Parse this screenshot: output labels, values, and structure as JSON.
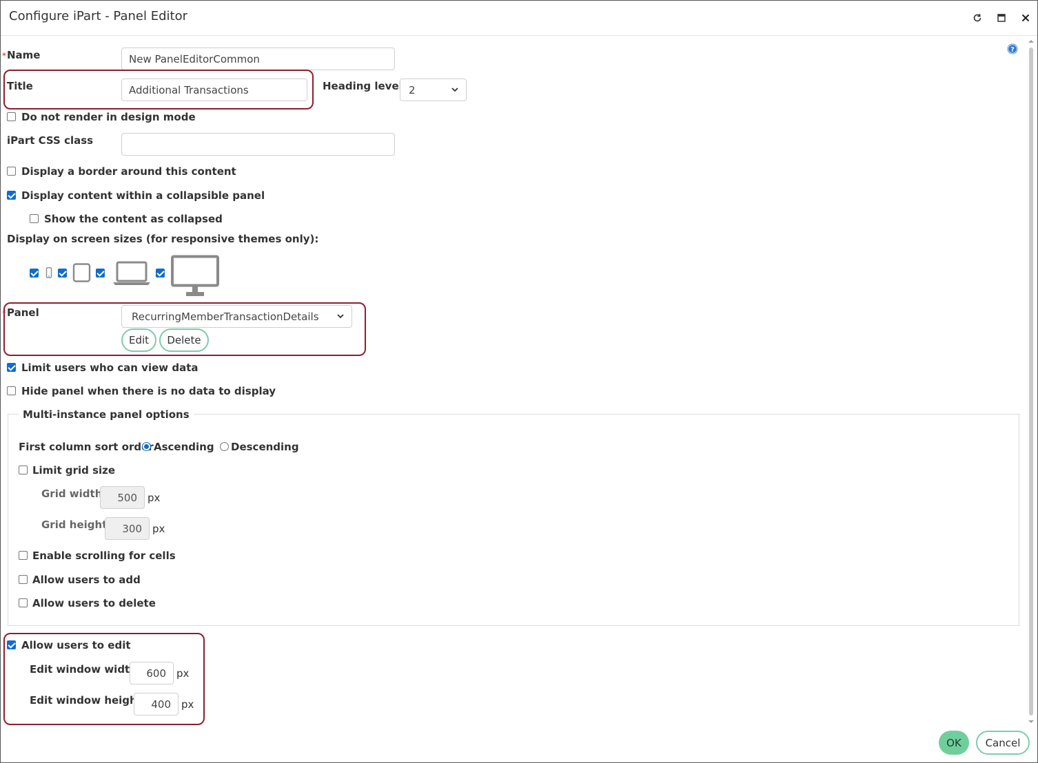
{
  "window": {
    "title": "Configure iPart - Panel Editor"
  },
  "form": {
    "name_label": "Name",
    "name_value": "New PanelEditorCommon",
    "title_label": "Title",
    "title_value": "Additional Transactions",
    "heading_level_label": "Heading level",
    "heading_level_value": "2",
    "no_render_label": "Do not render in design mode",
    "css_class_label": "iPart CSS class",
    "css_class_value": "",
    "border_label": "Display a border around this content",
    "collapsible_label": "Display content within a collapsible panel",
    "collapsed_label": "Show the content as collapsed",
    "screen_sizes_label": "Display on screen sizes (for responsive themes only):",
    "panel_label": "Panel",
    "panel_value": "RecurringMemberTransactionDetails",
    "edit_button": "Edit",
    "delete_button": "Delete",
    "limit_view_label": "Limit users who can view data",
    "hide_panel_label": "Hide panel when there is no data to display"
  },
  "multi": {
    "legend": "Multi-instance panel options",
    "sort_label": "First column sort order",
    "ascending": "Ascending",
    "descending": "Descending",
    "limit_grid_label": "Limit grid size",
    "grid_width_label": "Grid width",
    "grid_width_value": "500",
    "grid_height_label": "Grid height",
    "grid_height_value": "300",
    "px": "px",
    "scrolling_label": "Enable scrolling for cells",
    "add_label": "Allow users to add",
    "delete_label": "Allow users to delete"
  },
  "edit": {
    "allow_edit_label": "Allow users to edit",
    "width_label": "Edit window width",
    "width_value": "600",
    "height_label": "Edit window height",
    "height_value": "400",
    "px": "px"
  },
  "footer": {
    "ok": "OK",
    "cancel": "Cancel"
  },
  "colors": {
    "highlight": "#8b1e2e",
    "accent": "#6fcf9c",
    "checkbox": "#0f6cd0"
  }
}
